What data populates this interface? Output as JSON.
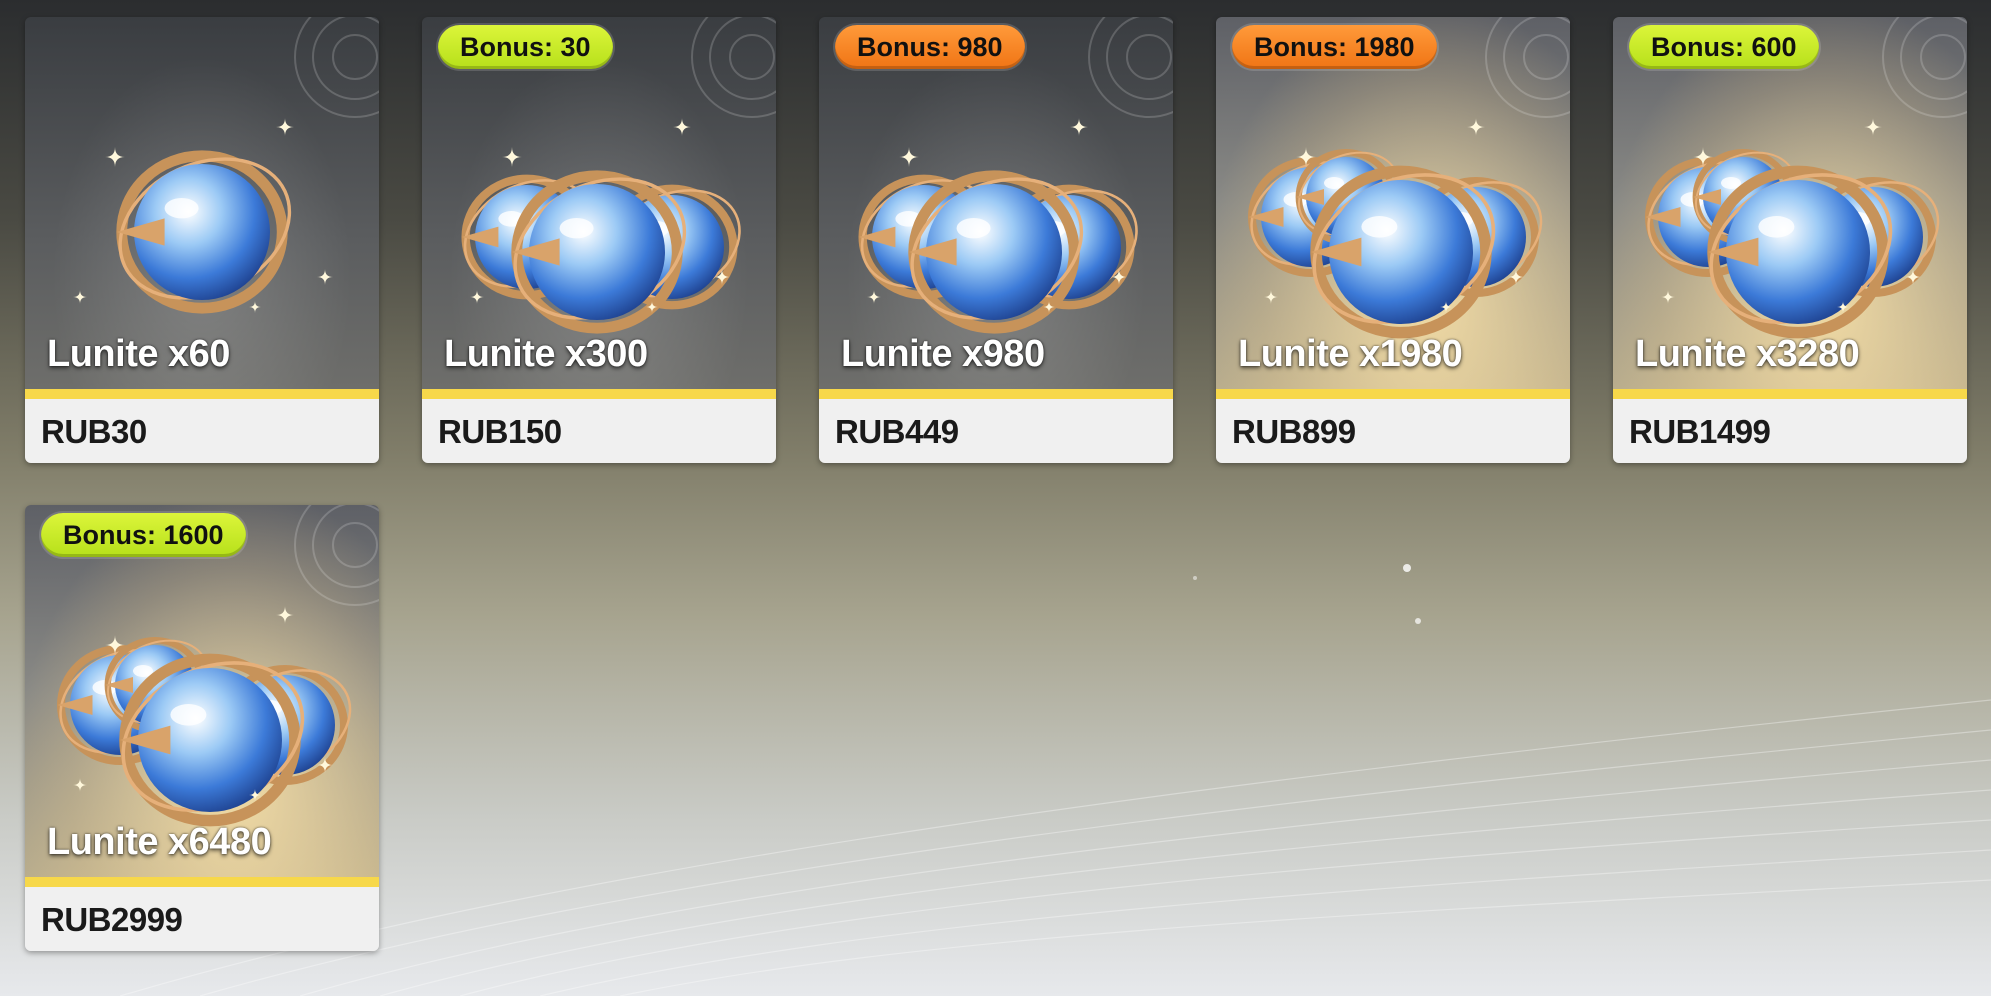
{
  "products": [
    {
      "name": "Lunite x60",
      "price": "RUB30",
      "bonus": "",
      "bonus_color": "none",
      "orbs": 1
    },
    {
      "name": "Lunite x300",
      "price": "RUB150",
      "bonus": "Bonus: 30",
      "bonus_color": "green",
      "orbs": 3
    },
    {
      "name": "Lunite x980",
      "price": "RUB449",
      "bonus": "Bonus: 980",
      "bonus_color": "orange",
      "orbs": 3
    },
    {
      "name": "Lunite x1980",
      "price": "RUB899",
      "bonus": "Bonus: 1980",
      "bonus_color": "orange",
      "orbs": 4
    },
    {
      "name": "Lunite x3280",
      "price": "RUB1499",
      "bonus": "Bonus: 600",
      "bonus_color": "green",
      "orbs": 4
    },
    {
      "name": "Lunite x6480",
      "price": "RUB2999",
      "bonus": "Bonus: 1600",
      "bonus_color": "green",
      "orbs": 4
    }
  ],
  "colors": {
    "bonus_green": "#c8ec26",
    "bonus_orange": "#f5841f",
    "price_stripe": "#f7d84a",
    "price_bg": "#f0f0f0"
  },
  "icons": [
    "lunite-orb-icon",
    "seal-emblem-icon",
    "sparkle-icon"
  ]
}
